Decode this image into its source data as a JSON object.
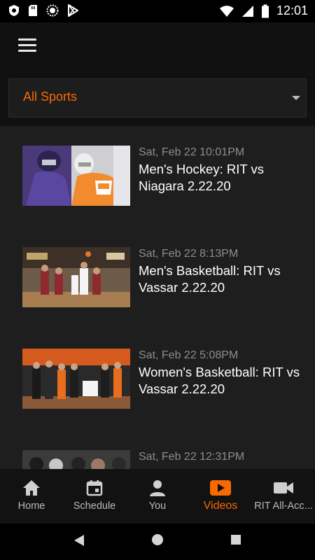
{
  "status_bar": {
    "time": "12:01",
    "left_icons": [
      "shield-icon",
      "sd-card-icon",
      "sync-circle-icon",
      "play-store-icon"
    ],
    "right_icons": [
      "wifi-icon",
      "cell-signal-icon",
      "battery-icon"
    ]
  },
  "app_bar": {
    "menu_icon": "hamburger-menu-icon",
    "filter": {
      "selected": "All Sports"
    }
  },
  "videos": [
    {
      "date": "Sat, Feb 22 10:01PM",
      "title": "Men's Hockey: RIT vs Niagara 2.22.20"
    },
    {
      "date": "Sat, Feb 22 8:13PM",
      "title": "Men's Basketball: RIT vs Vassar 2.22.20"
    },
    {
      "date": "Sat, Feb 22 5:08PM",
      "title": "Women's Basketball: RIT vs Vassar 2.22.20"
    },
    {
      "date": "Sat, Feb 22 12:31PM",
      "title": ""
    }
  ],
  "bottom_nav": {
    "items": [
      {
        "label": "Home",
        "icon": "home-icon"
      },
      {
        "label": "Schedule",
        "icon": "calendar-icon"
      },
      {
        "label": "You",
        "icon": "person-icon"
      },
      {
        "label": "Videos",
        "icon": "video-play-icon"
      },
      {
        "label": "RIT All-Acc...",
        "icon": "videocam-icon"
      }
    ],
    "active": "Videos"
  },
  "colors": {
    "accent": "#f76902",
    "background": "#1e1e1e",
    "app_bar": "#111111",
    "muted_text": "#8d8d8d"
  }
}
